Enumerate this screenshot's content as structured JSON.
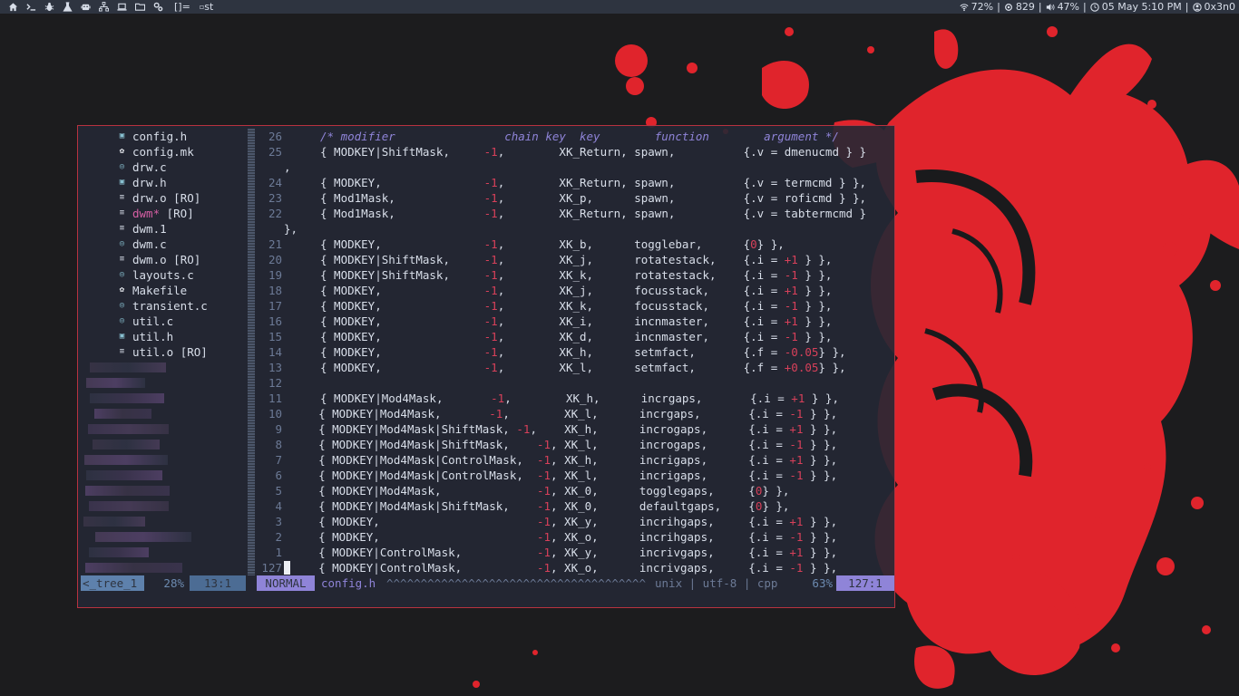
{
  "topbar": {
    "icons": [
      "home-icon",
      "terminal-icon",
      "bug-icon",
      "flask-icon",
      "robot-icon",
      "network-icon",
      "laptop-icon",
      "folder-icon",
      "gears-icon"
    ],
    "layout_symbol": "[]=",
    "window_title": "st",
    "wifi": "72%",
    "cpu": "829",
    "volume": "47%",
    "datetime": "05 May 5:10 PM",
    "user": "0x3n0",
    "sep": "|"
  },
  "tree": {
    "items": [
      {
        "label": "config.h",
        "icon": "header-icon",
        "suffix": ""
      },
      {
        "label": "config.mk",
        "icon": "gear-icon",
        "suffix": ""
      },
      {
        "label": "drw.c",
        "icon": "c-file-icon",
        "suffix": ""
      },
      {
        "label": "drw.h",
        "icon": "header-icon",
        "suffix": ""
      },
      {
        "label": "drw.o",
        "icon": "binary-icon",
        "suffix": " [RO]"
      },
      {
        "label": "dwm*",
        "icon": "binary-icon",
        "suffix": " [RO]",
        "modified": true
      },
      {
        "label": "dwm.1",
        "icon": "text-icon",
        "suffix": ""
      },
      {
        "label": "dwm.c",
        "icon": "c-file-icon",
        "suffix": ""
      },
      {
        "label": "dwm.o",
        "icon": "binary-icon",
        "suffix": " [RO]"
      },
      {
        "label": "layouts.c",
        "icon": "c-file-icon",
        "suffix": ""
      },
      {
        "label": "Makefile",
        "icon": "gear-icon",
        "suffix": ""
      },
      {
        "label": "transient.c",
        "icon": "c-file-icon",
        "suffix": ""
      },
      {
        "label": "util.c",
        "icon": "c-file-icon",
        "suffix": ""
      },
      {
        "label": "util.h",
        "icon": "header-icon",
        "suffix": ""
      },
      {
        "label": "util.o",
        "icon": "binary-icon",
        "suffix": " [RO]"
      }
    ]
  },
  "editor": {
    "lines": [
      {
        "num": "26",
        "code": "/* modifier                chain key  key        function        argument */",
        "comment": true
      },
      {
        "num": "25",
        "code": "{ MODKEY|ShiftMask,     -1,        XK_Return, spawn,          {.v = dmenucmd } }"
      },
      {
        "num": "",
        "code": ",",
        "cont": true
      },
      {
        "num": "24",
        "code": "{ MODKEY,               -1,        XK_Return, spawn,          {.v = termcmd } },"
      },
      {
        "num": "23",
        "code": "{ Mod1Mask,             -1,        XK_p,      spawn,          {.v = roficmd } },"
      },
      {
        "num": "22",
        "code": "{ Mod1Mask,             -1,        XK_Return, spawn,          {.v = tabtermcmd }"
      },
      {
        "num": "",
        "code": "},",
        "cont": true
      },
      {
        "num": "21",
        "code": "{ MODKEY,               -1,        XK_b,      togglebar,      {0} },"
      },
      {
        "num": "20",
        "code": "{ MODKEY|ShiftMask,     -1,        XK_j,      rotatestack,    {.i = +1 } },"
      },
      {
        "num": "19",
        "code": "{ MODKEY|ShiftMask,     -1,        XK_k,      rotatestack,    {.i = -1 } },"
      },
      {
        "num": "18",
        "code": "{ MODKEY,               -1,        XK_j,      focusstack,     {.i = +1 } },"
      },
      {
        "num": "17",
        "code": "{ MODKEY,               -1,        XK_k,      focusstack,     {.i = -1 } },"
      },
      {
        "num": "16",
        "code": "{ MODKEY,               -1,        XK_i,      incnmaster,     {.i = +1 } },"
      },
      {
        "num": "15",
        "code": "{ MODKEY,               -1,        XK_d,      incnmaster,     {.i = -1 } },"
      },
      {
        "num": "14",
        "code": "{ MODKEY,               -1,        XK_h,      setmfact,       {.f = -0.05} },"
      },
      {
        "num": "13",
        "code": "{ MODKEY,               -1,        XK_l,      setmfact,       {.f = +0.05} },"
      },
      {
        "num": "12",
        "code": ""
      },
      {
        "num": "11",
        "code": "{ MODKEY|Mod4Mask,       -1,        XK_h,      incrgaps,       {.i = +1 } },"
      },
      {
        "num": "10",
        "code": "    { MODKEY|Mod4Mask,       -1,        XK_l,      incrgaps,       {.i = -1 } },"
      },
      {
        "num": "9",
        "code": "    { MODKEY|Mod4Mask|ShiftMask, -1,    XK_h,      incrogaps,      {.i = +1 } },"
      },
      {
        "num": "8",
        "code": "    { MODKEY|Mod4Mask|ShiftMask,    -1, XK_l,      incrogaps,      {.i = -1 } },"
      },
      {
        "num": "7",
        "code": "    { MODKEY|Mod4Mask|ControlMask,  -1, XK_h,      incrigaps,      {.i = +1 } },"
      },
      {
        "num": "6",
        "code": "    { MODKEY|Mod4Mask|ControlMask,  -1, XK_l,      incrigaps,      {.i = -1 } },"
      },
      {
        "num": "5",
        "code": "    { MODKEY|Mod4Mask,              -1, XK_0,      togglegaps,     {0} },"
      },
      {
        "num": "4",
        "code": "    { MODKEY|Mod4Mask|ShiftMask,    -1, XK_0,      defaultgaps,    {0} },"
      },
      {
        "num": "3",
        "code": "    { MODKEY,                       -1, XK_y,      incrihgaps,     {.i = +1 } },"
      },
      {
        "num": "2",
        "code": "    { MODKEY,                       -1, XK_o,      incrihgaps,     {.i = -1 } },"
      },
      {
        "num": "1",
        "code": "    { MODKEY|ControlMask,           -1, XK_y,      incrivgaps,     {.i = +1 } },"
      },
      {
        "num": "127",
        "code": "    { MODKEY|ControlMask,           -1, XK_o,      incrivgaps,     {.i = -1 } },",
        "cursor": true
      }
    ]
  },
  "status": {
    "tree_name": "<_tree_1",
    "tree_percent": "28%",
    "tree_pos": "13:1",
    "mode": "NORMAL",
    "file": "config.h",
    "fill": "^^^^^^^^^^^^^^^^^^^^^^^^^^^^^^^^^^^^^^",
    "format": "unix | utf-8 | cpp",
    "percent": "63%",
    "position": "127:1"
  },
  "colors": {
    "accent_red": "#e0242c",
    "window_border": "#b8323f",
    "comment": "#8f84d8",
    "number": "#d7405a",
    "statusbar_bg": "#2e3440"
  }
}
